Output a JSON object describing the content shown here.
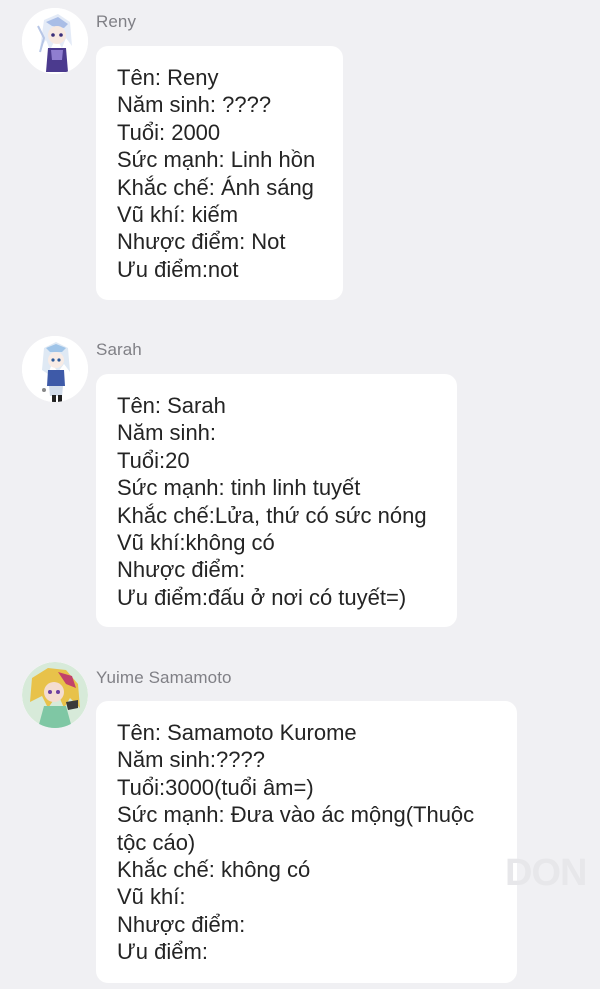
{
  "messages": [
    {
      "sender": "Reny",
      "lines": [
        "Tên: Reny",
        "Năm sinh: ????",
        "Tuổi: 2000",
        "Sức mạnh: Linh hồn",
        "Khắc chế: Ánh sáng",
        "Vũ khí: kiếm",
        "Nhược điểm: Not",
        "Ưu điểm:not"
      ]
    },
    {
      "sender": "Sarah",
      "lines": [
        "Tên: Sarah",
        "Năm sinh:",
        "Tuổi:20",
        "Sức mạnh: tinh linh tuyết",
        "Khắc chế:Lửa, thứ có sức nóng",
        "Vũ khí:không có",
        "Nhược điểm:",
        "Ưu điểm:đấu ở nơi có tuyết=)"
      ]
    },
    {
      "sender": "Yuime Samamoto",
      "lines": [
        "Tên: Samamoto Kurome",
        "Năm sinh:????",
        "Tuổi:3000(tuổi âm=)",
        "Sức mạnh: Đưa vào ác mộng(Thuộc tộc cáo)",
        "Khắc chế: không có",
        "Vũ khí:",
        "Nhược điểm:",
        "Ưu điểm:"
      ]
    }
  ],
  "watermark": "DON",
  "colors": {
    "background": "#f0f0f3",
    "bubble": "#ffffff",
    "sender_name": "#808086",
    "text": "#242424"
  }
}
